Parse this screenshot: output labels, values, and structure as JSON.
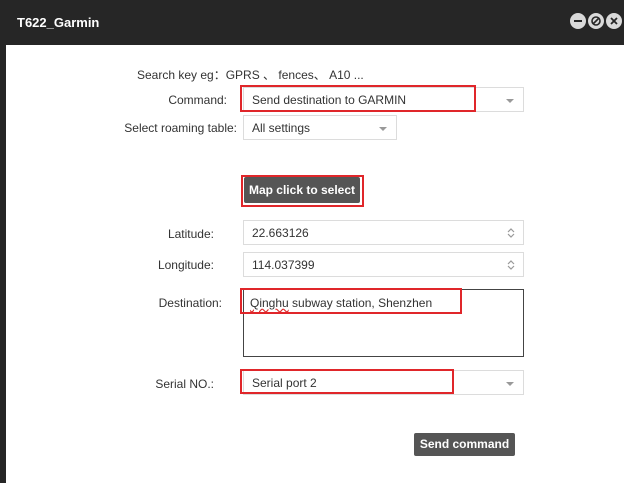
{
  "window": {
    "title": "T622_Garmin"
  },
  "form": {
    "search_hint": "Search key eg：GPRS 、 fences、 A10 ...",
    "command_label": "Command:",
    "command_value": "Send destination to GARMIN",
    "roaming_label": "Select roaming table:",
    "roaming_value": "All settings",
    "map_button": "Map click to select",
    "latitude_label": "Latitude:",
    "latitude_value": "22.663126",
    "longitude_label": "Longitude:",
    "longitude_value": "114.037399",
    "destination_label": "Destination:",
    "destination_word1": "Qinghu",
    "destination_rest": " subway station, Shenzhen",
    "serial_label": "Serial NO.:",
    "serial_value": "Serial port 2",
    "send_button": "Send command"
  },
  "colors": {
    "titlebar": "#262626",
    "highlight": "#e0262a",
    "button": "#555555"
  },
  "icons": [
    "minimize-icon",
    "restore-icon",
    "close-icon",
    "chevron-down-icon",
    "spinner-icon"
  ]
}
